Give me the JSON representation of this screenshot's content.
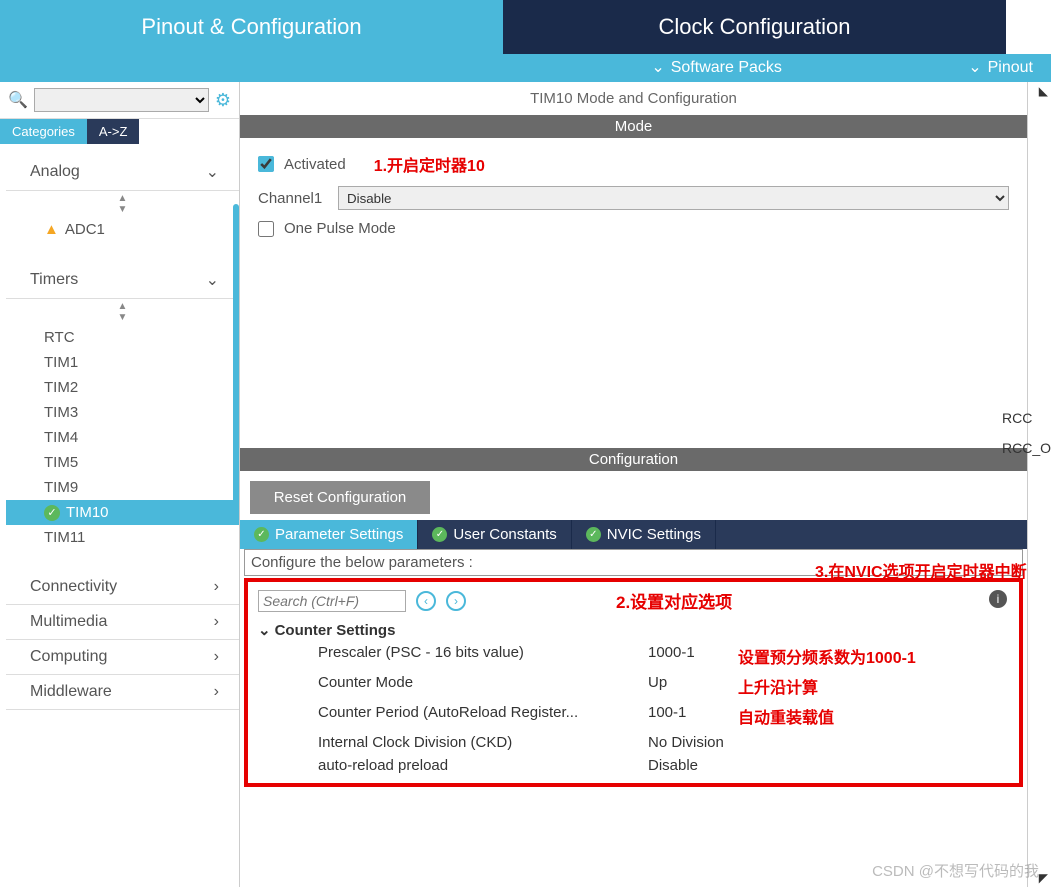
{
  "topnav": {
    "tab1": "Pinout & Configuration",
    "tab2": "Clock Configuration"
  },
  "subnav": {
    "software": "Software Packs",
    "pinout": "Pinout"
  },
  "sidebar": {
    "tab_categories": "Categories",
    "tab_az": "A->Z",
    "groups": {
      "analog": "Analog",
      "timers": "Timers",
      "connectivity": "Connectivity",
      "multimedia": "Multimedia",
      "computing": "Computing",
      "middleware": "Middleware"
    },
    "analog_items": {
      "adc1": "ADC1"
    },
    "timers_items": {
      "rtc": "RTC",
      "tim1": "TIM1",
      "tim2": "TIM2",
      "tim3": "TIM3",
      "tim4": "TIM4",
      "tim5": "TIM5",
      "tim9": "TIM9",
      "tim10": "TIM10",
      "tim11": "TIM11"
    }
  },
  "content": {
    "title": "TIM10 Mode and Configuration",
    "mode_header": "Mode",
    "config_header": "Configuration",
    "activated_label": "Activated",
    "channel1_label": "Channel1",
    "channel1_value": "Disable",
    "opm_label": "One Pulse Mode",
    "reset_btn": "Reset Configuration",
    "tabs": {
      "param": "Parameter Settings",
      "user": "User Constants",
      "nvic": "NVIC Settings"
    },
    "configure_desc": "Configure the below parameters :",
    "search_placeholder": "Search (Ctrl+F)",
    "counter_settings": "Counter Settings",
    "params": {
      "prescaler_l": "Prescaler (PSC - 16 bits value)",
      "prescaler_v": "1000-1",
      "mode_l": "Counter Mode",
      "mode_v": "Up",
      "period_l": "Counter Period (AutoReload Register...",
      "period_v": "100-1",
      "ckd_l": "Internal Clock Division (CKD)",
      "ckd_v": "No Division",
      "arp_l": "auto-reload preload",
      "arp_v": "Disable"
    }
  },
  "annotations": {
    "a1": "1.开启定时器10",
    "a2": "2.设置对应选项",
    "a3": "3.在NVIC选项开启定时器中断",
    "prescaler": "设置预分频系数为1000-1",
    "mode": "上升沿计算",
    "period": "自动重装载值"
  },
  "overflow": {
    "rcc": "RCC",
    "rcc_o": "RCC_O"
  },
  "watermark": "CSDN @不想写代码的我"
}
